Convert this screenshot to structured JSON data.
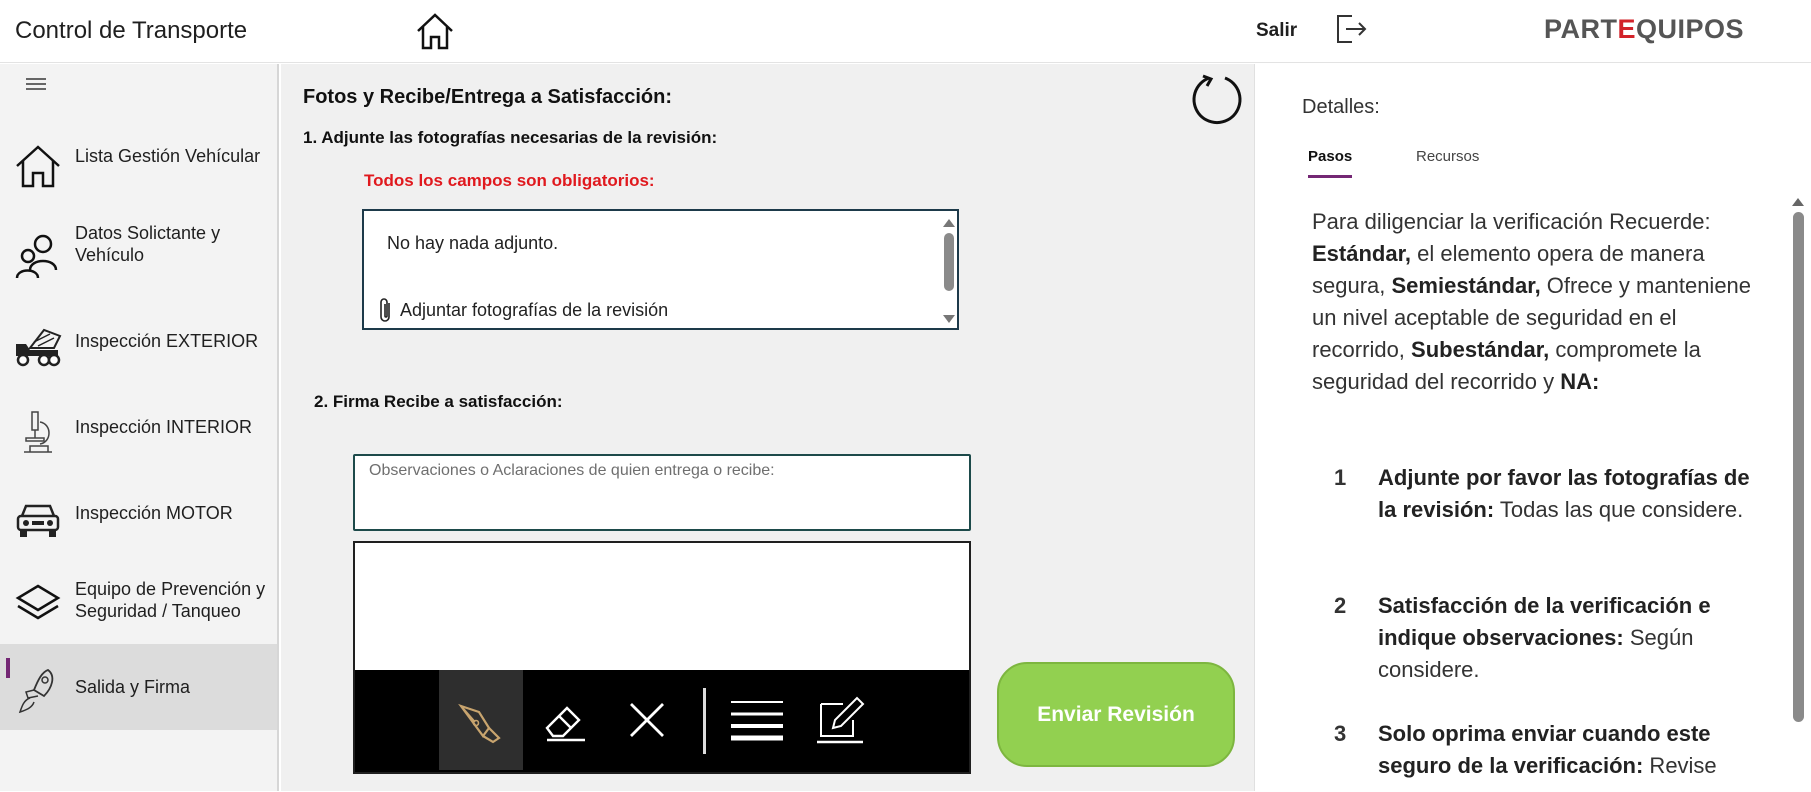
{
  "header": {
    "title": "Control de Transporte",
    "salir_label": "Salir",
    "logo_text_left": "PART",
    "logo_text_gear": "E",
    "logo_text_right": "QUIPOS"
  },
  "sidebar": {
    "items": [
      {
        "label": "Lista  Gestión Vehícular",
        "icon": "home-icon"
      },
      {
        "label": "Datos Solictante y Vehículo",
        "icon": "people-icon"
      },
      {
        "label": "Inspección EXTERIOR",
        "icon": "dump-truck-icon"
      },
      {
        "label": "Inspección INTERIOR",
        "icon": "microscope-icon"
      },
      {
        "label": "Inspección MOTOR",
        "icon": "car-front-icon"
      },
      {
        "label": "Equipo de Prevención y Seguridad / Tanqueo",
        "icon": "layers-icon"
      },
      {
        "label": "Salida y Firma",
        "icon": "rocket-icon",
        "active": true
      }
    ]
  },
  "main": {
    "section_title": "Fotos y Recibe/Entrega a Satisfacción:",
    "step1_label": "1. Adjunte las fotografías necesarias de la revisión:",
    "required_note": "Todos los campos son obligatorios:",
    "attachments_empty": "No hay nada adjunto.",
    "attach_link": "Adjuntar fotografías de la revisión",
    "step2_label": "2. Firma Recibe a satisfacción:",
    "observations_placeholder": "Observaciones o Aclaraciones de quien entrega o recibe:",
    "send_button": "Enviar Revisión",
    "colors": {
      "required": "#e0191e",
      "send_button": "#92d050",
      "accent": "#742774"
    }
  },
  "details": {
    "title": "Detalles:",
    "tabs": [
      {
        "label": "Pasos",
        "selected": true
      },
      {
        "label": "Recursos",
        "selected": false
      }
    ],
    "intro_1": "Para diligenciar la verificación Recuerde: ",
    "estandar": "Estándar,",
    "intro_2": " el elemento opera de manera segura, ",
    "semiestandar": "Semiestándar,",
    "intro_3": " Ofrece y manteniene un nivel aceptable de seguridad en el recorrido, ",
    "subestandar": "Subestándar,",
    "intro_4": " compromete la seguridad del recorrido y ",
    "na": "NA:",
    "steps": [
      {
        "num": "1",
        "bold": "Adjunte por favor las fotografías de la revisión:",
        "text": " Todas las que considere."
      },
      {
        "num": "2",
        "bold": "Satisfacción de la verificación e indique observaciones:",
        "text": " Según considere."
      },
      {
        "num": "3",
        "bold": "Solo oprima enviar cuando este seguro de la verificación:",
        "text": " Revise"
      }
    ]
  }
}
